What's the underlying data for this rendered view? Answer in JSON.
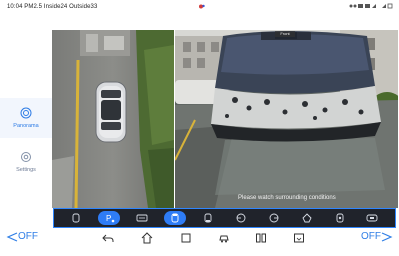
{
  "statusbar": {
    "info": "10:04 PM2.5 Inside24 Outside33",
    "indicators": [
      "signal-icon",
      "wifi-icon",
      "battery-icon"
    ]
  },
  "sidebar": {
    "items": [
      {
        "label": "Panorama",
        "icon": "panorama-icon",
        "active": true
      },
      {
        "label": "Settings",
        "icon": "gear-icon",
        "active": false
      }
    ]
  },
  "camera": {
    "right_tag": "Front",
    "warning": "Please watch surrounding conditions"
  },
  "toolbar": {
    "buttons": [
      {
        "icon": "car-view-icon",
        "active": false
      },
      {
        "icon": "parking-icon",
        "label": "P",
        "active": true
      },
      {
        "icon": "radar-icon",
        "active": false
      },
      {
        "icon": "front-view-icon",
        "active": true
      },
      {
        "icon": "side-view-icon",
        "active": false
      },
      {
        "icon": "left-view-icon",
        "active": false
      },
      {
        "icon": "right-view-icon",
        "active": false
      },
      {
        "icon": "rear-view-icon",
        "active": false
      },
      {
        "icon": "3d-view-icon",
        "active": false
      },
      {
        "icon": "wide-view-icon",
        "active": false
      }
    ]
  },
  "navbar": {
    "left_off": "OFF",
    "right_off": "OFF",
    "icons": [
      "back-icon",
      "home-icon",
      "recents-icon",
      "car-settings-icon",
      "split-view-icon",
      "screen-icon"
    ]
  },
  "colors": {
    "accent": "#2e7cf6",
    "toolbar_bg": "#20232b",
    "sidebar_text": "#6e7c96"
  }
}
